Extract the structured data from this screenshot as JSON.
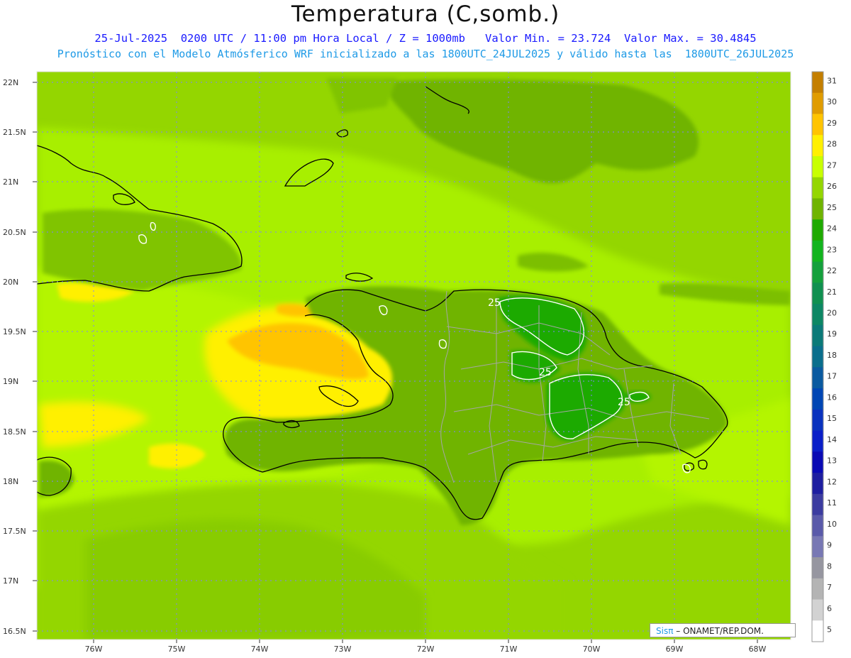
{
  "header": {
    "title": "Temperatura (C,somb.)",
    "line1": "25-Jul-2025  0200 UTC / 11:00 pm Hora Local / Z = 1000mb   Valor Min. = 23.724  Valor Max. = 30.4845",
    "line2": "Pronóstico con el Modelo Atmósferico WRF inicializado a las 1800UTC_24JUL2025 y válido hasta las  1800UTC_26JUL2025"
  },
  "map": {
    "lat_labels": [
      "22N",
      "21.5N",
      "21N",
      "20.5N",
      "20N",
      "19.5N",
      "19N",
      "18.5N",
      "18N",
      "17.5N",
      "17N",
      "16.5N"
    ],
    "lon_labels": [
      "76W",
      "75W",
      "74W",
      "73W",
      "72W",
      "71W",
      "70W",
      "69W",
      "68W"
    ],
    "contour_labels": [
      "25",
      "25",
      "25"
    ]
  },
  "colorbar": {
    "labels": [
      "31",
      "30",
      "29",
      "28",
      "27",
      "26",
      "25",
      "24",
      "23",
      "22",
      "21",
      "20",
      "19",
      "18",
      "17",
      "16",
      "15",
      "14",
      "13",
      "12",
      "11",
      "10",
      "9",
      "8",
      "7",
      "6",
      "5"
    ],
    "colors": [
      "#c47f00",
      "#e09c00",
      "#ffc400",
      "#fff000",
      "#c8ff00",
      "#94d600",
      "#6fb400",
      "#1eaa00",
      "#12b41e",
      "#14a03c",
      "#109050",
      "#0d8764",
      "#0b7a78",
      "#0a6e8c",
      "#0a5aa0",
      "#0046b4",
      "#0a32be",
      "#0a1ec8",
      "#0a0ab4",
      "#1e1ea0",
      "#3c3ca0",
      "#5a5aaa",
      "#7878b4",
      "#9696a0",
      "#b4b4b4",
      "#d2d2d2",
      "#ffffff"
    ]
  },
  "credit": {
    "brand": "Sisπ",
    "rest": " – ONAMET/REP.DOM."
  }
}
